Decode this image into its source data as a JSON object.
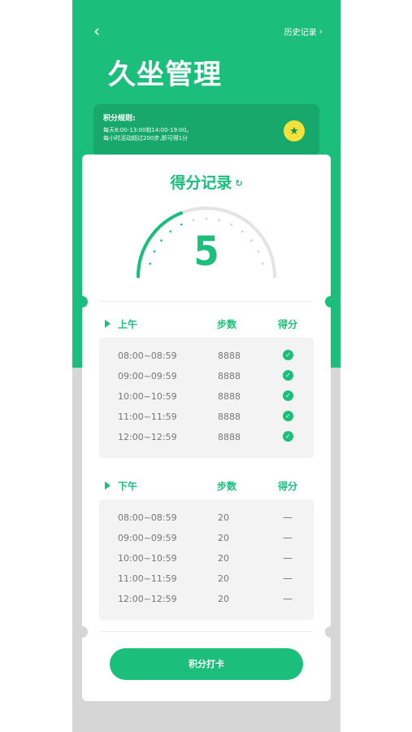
{
  "header": {
    "back_icon": "chevron-left-icon",
    "history_label": "历史记录",
    "title": "久坐管理"
  },
  "rules": {
    "title": "积分规则:",
    "line1": "每天8:00-13:00和14:00-19:00。",
    "line2": "每小时活动超过200步,即可得1分",
    "badge_icon": "star-icon"
  },
  "card": {
    "title": "得分记录",
    "refresh_icon": "refresh-icon",
    "score": "5",
    "score_fraction": 0.38
  },
  "morning": {
    "label": "上午",
    "col_steps": "步数",
    "col_score": "得分",
    "rows": [
      {
        "time": "08:00~08:59",
        "steps": "8888",
        "score": "check"
      },
      {
        "time": "09:00~09:59",
        "steps": "8888",
        "score": "check"
      },
      {
        "time": "10:00~10:59",
        "steps": "8888",
        "score": "check"
      },
      {
        "time": "11:00~11:59",
        "steps": "8888",
        "score": "check"
      },
      {
        "time": "12:00~12:59",
        "steps": "8888",
        "score": "check"
      }
    ]
  },
  "afternoon": {
    "label": "下午",
    "col_steps": "步数",
    "col_score": "得分",
    "rows": [
      {
        "time": "08:00~08:59",
        "steps": "20",
        "score": "—"
      },
      {
        "time": "09:00~09:59",
        "steps": "20",
        "score": "—"
      },
      {
        "time": "10:00~10:59",
        "steps": "20",
        "score": "—"
      },
      {
        "time": "11:00~11:59",
        "steps": "20",
        "score": "—"
      },
      {
        "time": "12:00~12:59",
        "steps": "20",
        "score": "—"
      }
    ]
  },
  "cta": {
    "label": "积分打卡"
  },
  "colors": {
    "primary": "#1bbe7a",
    "badge": "#f2e23a"
  }
}
